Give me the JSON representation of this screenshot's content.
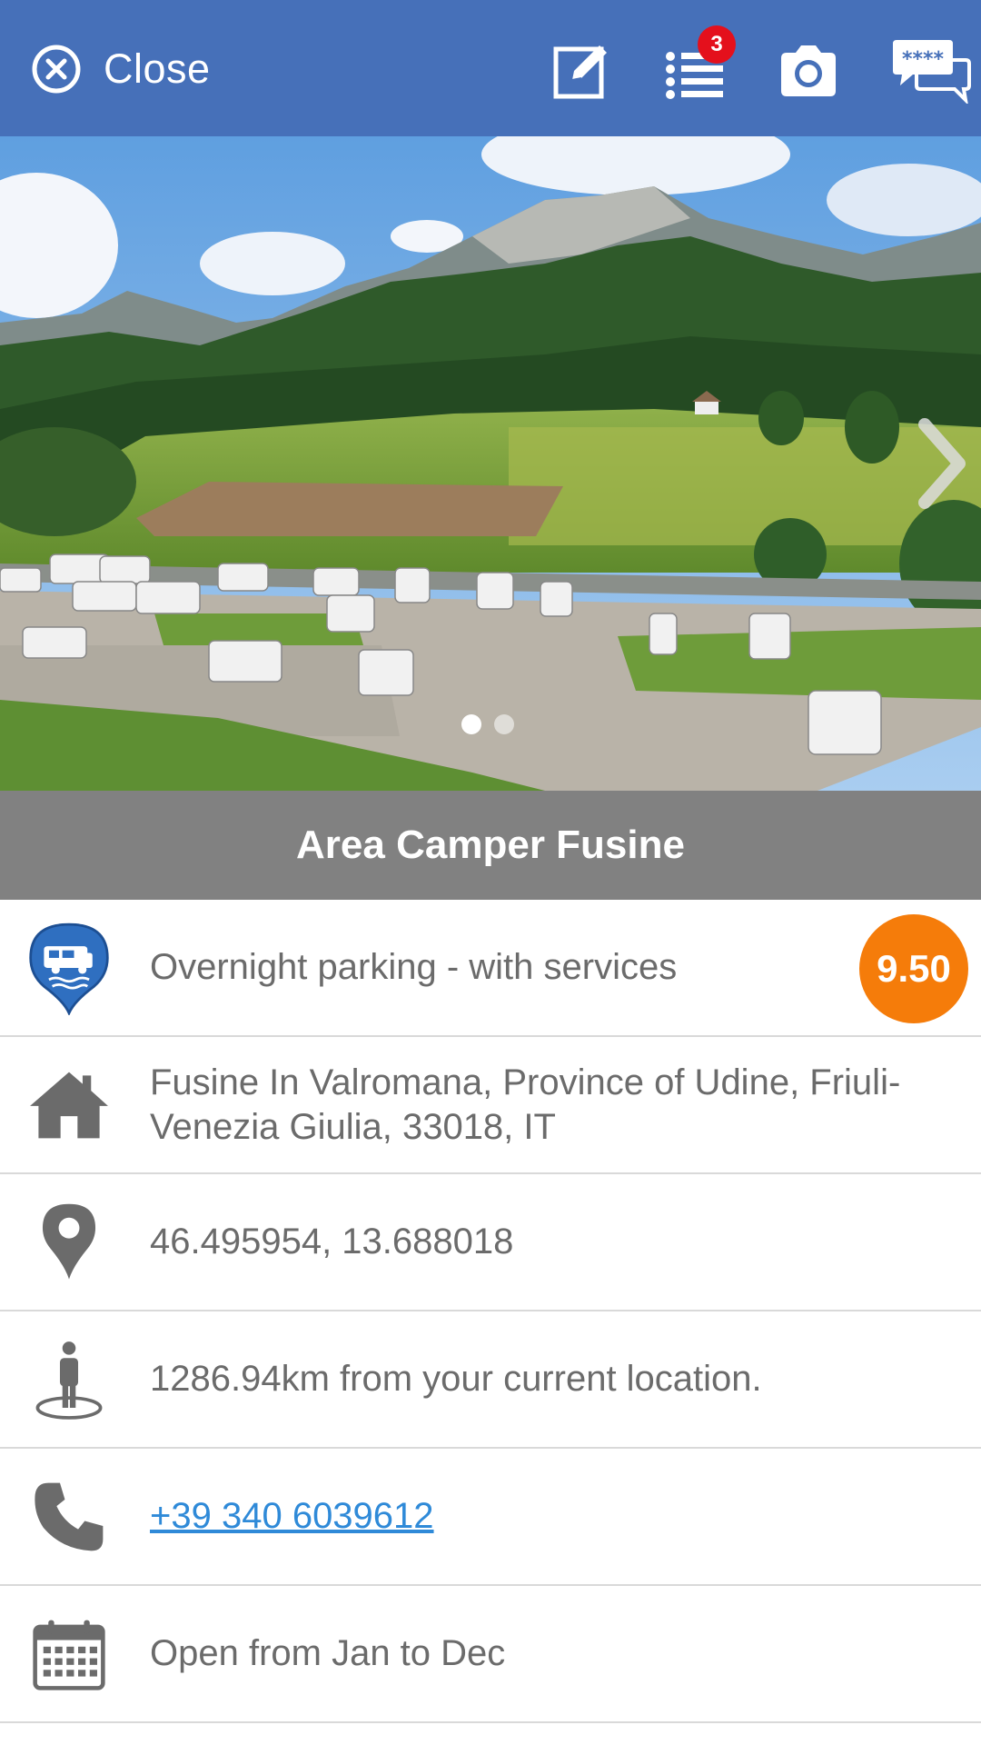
{
  "header": {
    "close_label": "Close",
    "list_badge": "3",
    "icons": [
      "close-circle-icon",
      "edit-icon",
      "list-icon",
      "camera-icon",
      "reviews-chat-icon"
    ]
  },
  "photo": {
    "slide_count": 2,
    "active_slide": 1
  },
  "place": {
    "name": "Area Camper Fusine",
    "category": "Overnight parking - with services",
    "rating": "9.50",
    "address": "Fusine In Valromana, Province of Udine, Friuli-Venezia Giulia, 33018, IT",
    "coordinates": "46.495954, 13.688018",
    "distance": "1286.94km from your current location.",
    "phone": "+39 340 6039612",
    "opening": "Open from Jan to Dec"
  },
  "colors": {
    "header_bg": "#4670b9",
    "title_band_bg": "#818181",
    "rating_bg": "#f57c0a",
    "badge_bg": "#e4101c",
    "link": "#2f8ad8",
    "open_text": "#1f8a1f"
  }
}
